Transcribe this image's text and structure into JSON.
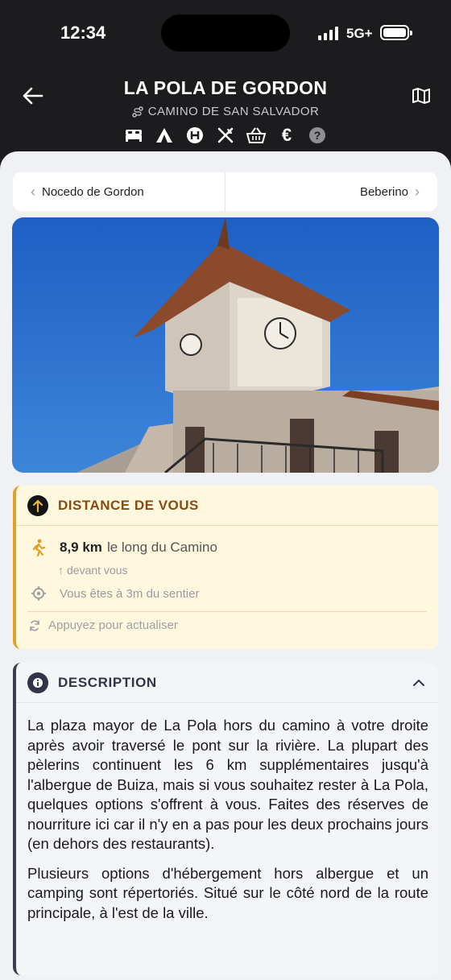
{
  "status_bar": {
    "time": "12:34",
    "network": "5G+"
  },
  "header": {
    "title": "LA POLA DE GORDON",
    "route": "CAMINO DE SAN SALVADOR",
    "amenities": [
      "bed-icon",
      "tent-icon",
      "hotel-h-icon",
      "restaurant-icon",
      "shopping-basket-icon",
      "euro-icon",
      "help-icon"
    ]
  },
  "nav": {
    "prev": "Nocedo de Gordon",
    "next": "Beberino"
  },
  "photo": {
    "alt_icon": "clock-tower-photo"
  },
  "distance_card": {
    "title": "DISTANCE DE VOUS",
    "km": "8,9 km",
    "along": "le long du Camino",
    "ahead": "devant vous",
    "offpath": "Vous êtes à 3m du sentier",
    "refresh": "Appuyez pour actualiser"
  },
  "description_card": {
    "title": "DESCRIPTION",
    "paragraphs": [
      "La plaza mayor de La Pola hors du camino à votre droite après avoir traversé le pont sur la rivière. La plupart des pèlerins continuent les 6 km supplémentaires jusqu'à l'albergue de Buiza, mais si vous souhaitez rester à La Pola, quelques options s'offrent à vous. Faites des réserves de nourriture ici car il n'y en a pas pour les deux prochains jours (en dehors des restaurants).",
      "Plusieurs options d'hébergement hors albergue et un camping sont répertoriés. Situé sur le côté nord de la route principale, à l'est de la ville."
    ]
  }
}
